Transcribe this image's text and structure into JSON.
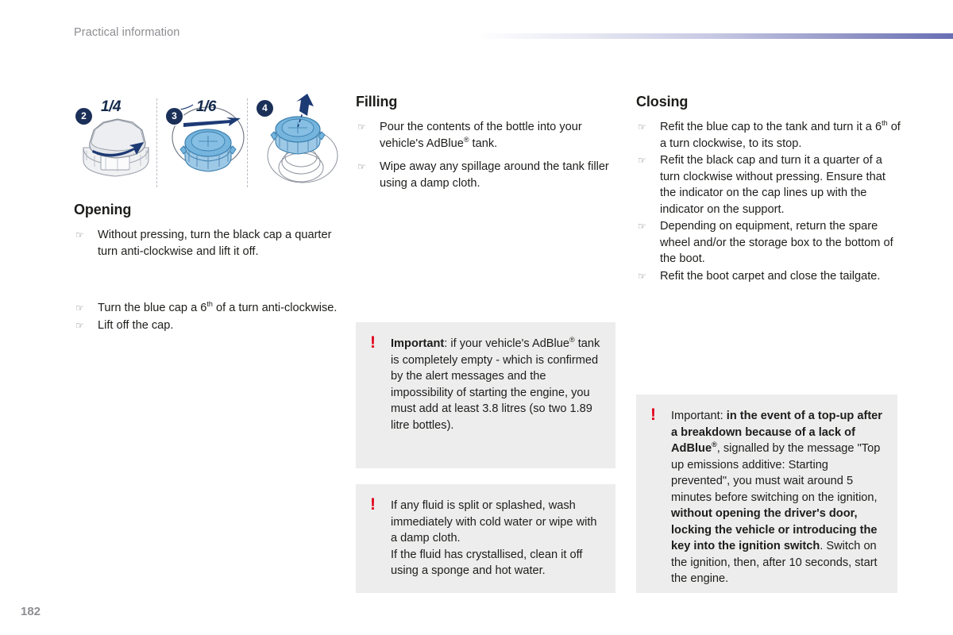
{
  "header": {
    "title": "Practical information",
    "rule_color_start": "#ffffff",
    "rule_color_end": "#686eb4"
  },
  "illustration": {
    "name": "adblue-cap-opening-steps",
    "panels": [
      {
        "badge": "2",
        "fraction": "1/4",
        "caption": "grey-black-cap-quarter-turn"
      },
      {
        "badge": "3",
        "fraction": "1/6",
        "caption": "blue-cap-sixth-turn"
      },
      {
        "badge": "4",
        "fraction": "",
        "caption": "lift-blue-cap-off-tank"
      }
    ],
    "badge_color": "#1b3058",
    "cap_blue": "#74b4dd",
    "cap_grey": "#e6e7ea"
  },
  "left_column": {
    "heading": "Opening",
    "items_group_1": [
      "Without pressing, turn the black cap a quarter turn anti-clockwise and lift it off."
    ],
    "items_group_2_a_pre": "Turn the blue cap a 6",
    "items_group_2_a_sup": "th",
    "items_group_2_a_post": " of a turn anti-clockwise.",
    "items_group_2_b": "Lift off the cap."
  },
  "middle_column": {
    "heading": "Filling",
    "item_1_pre": "Pour the contents of the bottle into your vehicle's AdBlue",
    "item_1_sup": "®",
    "item_1_post": " tank.",
    "item_2": "Wipe away any spillage around the tank filler using a damp cloth."
  },
  "right_column": {
    "heading": "Closing",
    "item_1_pre": "Refit the blue cap to the tank and turn it a 6",
    "item_1_sup": "th",
    "item_1_post": " of a turn clockwise, to its stop.",
    "item_2": "Refit the black cap and turn it a quarter of a turn clockwise without pressing. Ensure that the indicator on the cap lines up with the indicator on the support.",
    "item_3": "Depending on equipment, return the spare wheel and/or the storage box to the bottom of the boot.",
    "item_4": "Refit the boot carpet and close the tailgate."
  },
  "notes": {
    "icon": "exclamation-icon",
    "icon_color": "#e2001a",
    "background": "#ededed",
    "middle_1": {
      "lead_bold": "Important",
      "part_a": ": if your vehicle's AdBlue",
      "sup_a": "®",
      "part_b": " tank is completely empty - which is confirmed by the alert messages and the impossibility of starting the engine, you must add at least 3.8 litres (so two 1.89 litre bottles)."
    },
    "middle_2": {
      "text": "If any fluid is split or splashed, wash immediately with cold water or wipe with a damp cloth.",
      "text_2": "If the fluid has crystallised, clean it off using a sponge and hot water."
    },
    "right": {
      "lead": "Important: ",
      "bold_a": "in the event of a top-up after a breakdown because of a lack of AdBlue",
      "sup_a": "®",
      "part_b": ", signalled by the message \"Top up emissions additive: Starting prevented\", you must wait around 5 minutes before switching on the ignition, ",
      "bold_b": "without opening the driver's door, locking the vehicle or introducing the key into the ignition switch",
      "part_c": ". Switch on the ignition, then, after 10 seconds, start the engine."
    }
  },
  "footer": {
    "page_number": "182"
  }
}
